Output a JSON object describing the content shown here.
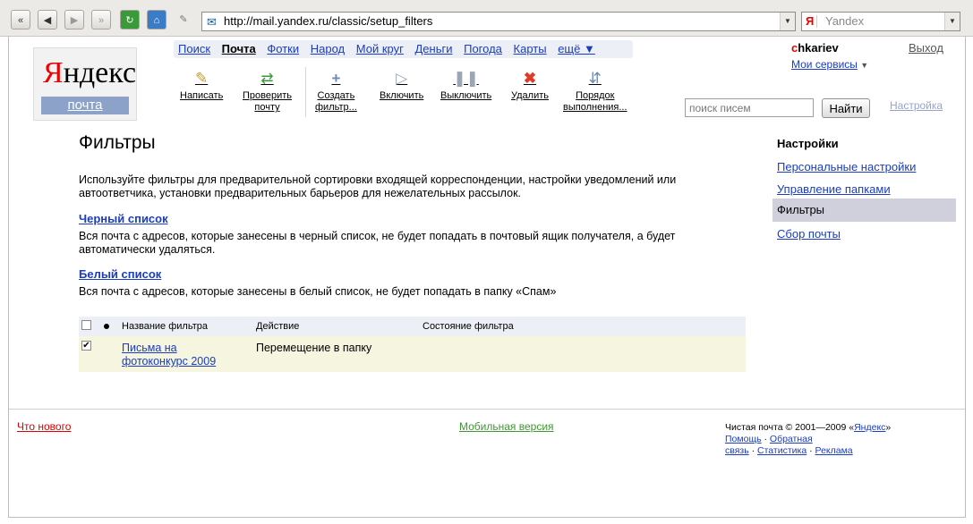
{
  "browser": {
    "url": "http://mail.yandex.ru/classic/setup_filters",
    "search_engine": "Yandex",
    "search_engine_logo": "Я"
  },
  "logo": {
    "word_red": "Я",
    "word_rest": "ндекс",
    "sub": "почта"
  },
  "services": [
    "Поиск",
    "Почта",
    "Фотки",
    "Народ",
    "Мой круг",
    "Деньги",
    "Погода",
    "Карты",
    "ещё ▼"
  ],
  "toolbar": {
    "write": [
      "Написать"
    ],
    "check": [
      "Проверить",
      "почту"
    ],
    "create": [
      "Создать",
      "фильтр..."
    ],
    "enable": [
      "Включить"
    ],
    "disable": [
      "Выключить"
    ],
    "delete": [
      "Удалить"
    ],
    "order": [
      "Порядок",
      "выполнения..."
    ]
  },
  "user": {
    "name_first": "c",
    "name_rest": "hkariev",
    "logout": "Выход",
    "my_services": "Мои сервисы",
    "my_services_arrow": "▼"
  },
  "mailsearch": {
    "placeholder": "поиск писем",
    "button": "Найти",
    "settings": "Настройка"
  },
  "main": {
    "title": "Фильтры",
    "intro": "Используйте фильтры для предварительной сортировки входящей корреспонденции, настройки уведомлений или автоответчика, установки предварительных барьеров для нежелательных рассылок.",
    "blacklist_title": "Черный список",
    "blacklist_text": "Вся почта с адресов, которые занесены в черный список, не будет попадать в почтовый ящик получателя, а будет автоматически удаляться.",
    "whitelist_title": "Белый список",
    "whitelist_text": "Вся почта с адресов, которые занесены в белый список, не будет попадать в папку «Спам»"
  },
  "table": {
    "headers": [
      "Название фильтра",
      "Действие",
      "Состояние фильтра"
    ],
    "rows": [
      {
        "name_line1": "Письма на",
        "name_line2": "фотоконкурс 2009",
        "action": "Перемещение в папку",
        "state": "",
        "checked": true
      }
    ]
  },
  "right_nav": {
    "title": "Настройки",
    "items": [
      "Персональные настройки",
      "Управление папками",
      "Фильтры",
      "Сбор почты"
    ]
  },
  "footer": {
    "whats_new": "Что нового",
    "mobile": "Мобильная версия",
    "copyright_prefix": "Чистая почта © 2001—2009 «",
    "copyright_link": "Яндекс",
    "copyright_suffix": "»",
    "links": [
      "Помощь",
      "Обратная",
      "связь",
      "Статистика",
      "Реклама"
    ],
    "separator": "·"
  },
  "colors": {
    "link": "#1a3dc1",
    "brand_red": "#e00000",
    "table_header_bg": "#eceff5",
    "table_row_bg": "#f5f5e0",
    "active_nav_bg": "#cfd0dc",
    "mobile_green": "#3d9a2e"
  },
  "icons": {
    "back": "back-arrow-icon",
    "forward": "forward-arrow-icon",
    "reload": "reload-icon",
    "home": "home-icon",
    "write": "pencil-icon",
    "check": "refresh-arrows-icon",
    "create": "plus-icon",
    "enable": "play-icon",
    "disable": "pause-icon",
    "delete": "red-x-icon",
    "order": "up-down-arrows-icon"
  }
}
